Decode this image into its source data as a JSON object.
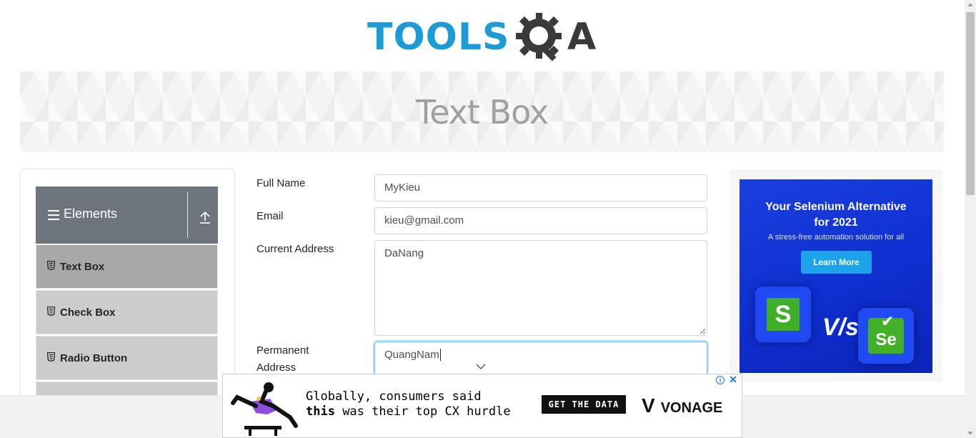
{
  "header": {
    "logo_text_left": "TOOLS",
    "logo_text_right": "A",
    "logo_colors": {
      "primary": "#1c9bd6",
      "secondary": "#3a3a3a"
    }
  },
  "banner": {
    "title": "Text Box"
  },
  "sidebar": {
    "group_title": "Elements",
    "group_icon": "hamburger-icon",
    "collapse_icon": "upload-icon",
    "items": [
      {
        "label": "Text Box",
        "icon": "html-file-icon",
        "active": true
      },
      {
        "label": "Check Box",
        "icon": "html-file-icon",
        "active": false
      },
      {
        "label": "Radio Button",
        "icon": "html-file-icon",
        "active": false
      }
    ]
  },
  "form": {
    "full_name": {
      "label": "Full Name",
      "value": "MyKieu"
    },
    "email": {
      "label": "Email",
      "value": "kieu@gmail.com"
    },
    "current_address": {
      "label": "Current Address",
      "value": "DaNang"
    },
    "permanent_address": {
      "label_line1": "Permanent",
      "label_line2": "Address",
      "value": "QuangNam"
    }
  },
  "side_ad": {
    "title_line1": "Your Selenium Alternative",
    "title_line2": "for 2021",
    "subtitle": "A stress-free automation solution for all",
    "button": "Learn More",
    "vs_text": "V/s",
    "logo_left": "S",
    "logo_right": "Se",
    "colors": {
      "background": "#1a3fe0",
      "button": "#1ca3ec",
      "green": "#43b02a"
    }
  },
  "bottom_ad": {
    "line1": "Globally, consumers said",
    "line2_bold": "this",
    "line2_rest": " was their top CX hurdle",
    "cta": "GET THE DATA",
    "brand": "VONAGE",
    "brand_mark": "V",
    "info_icon": "i",
    "close_icon": "✕"
  }
}
